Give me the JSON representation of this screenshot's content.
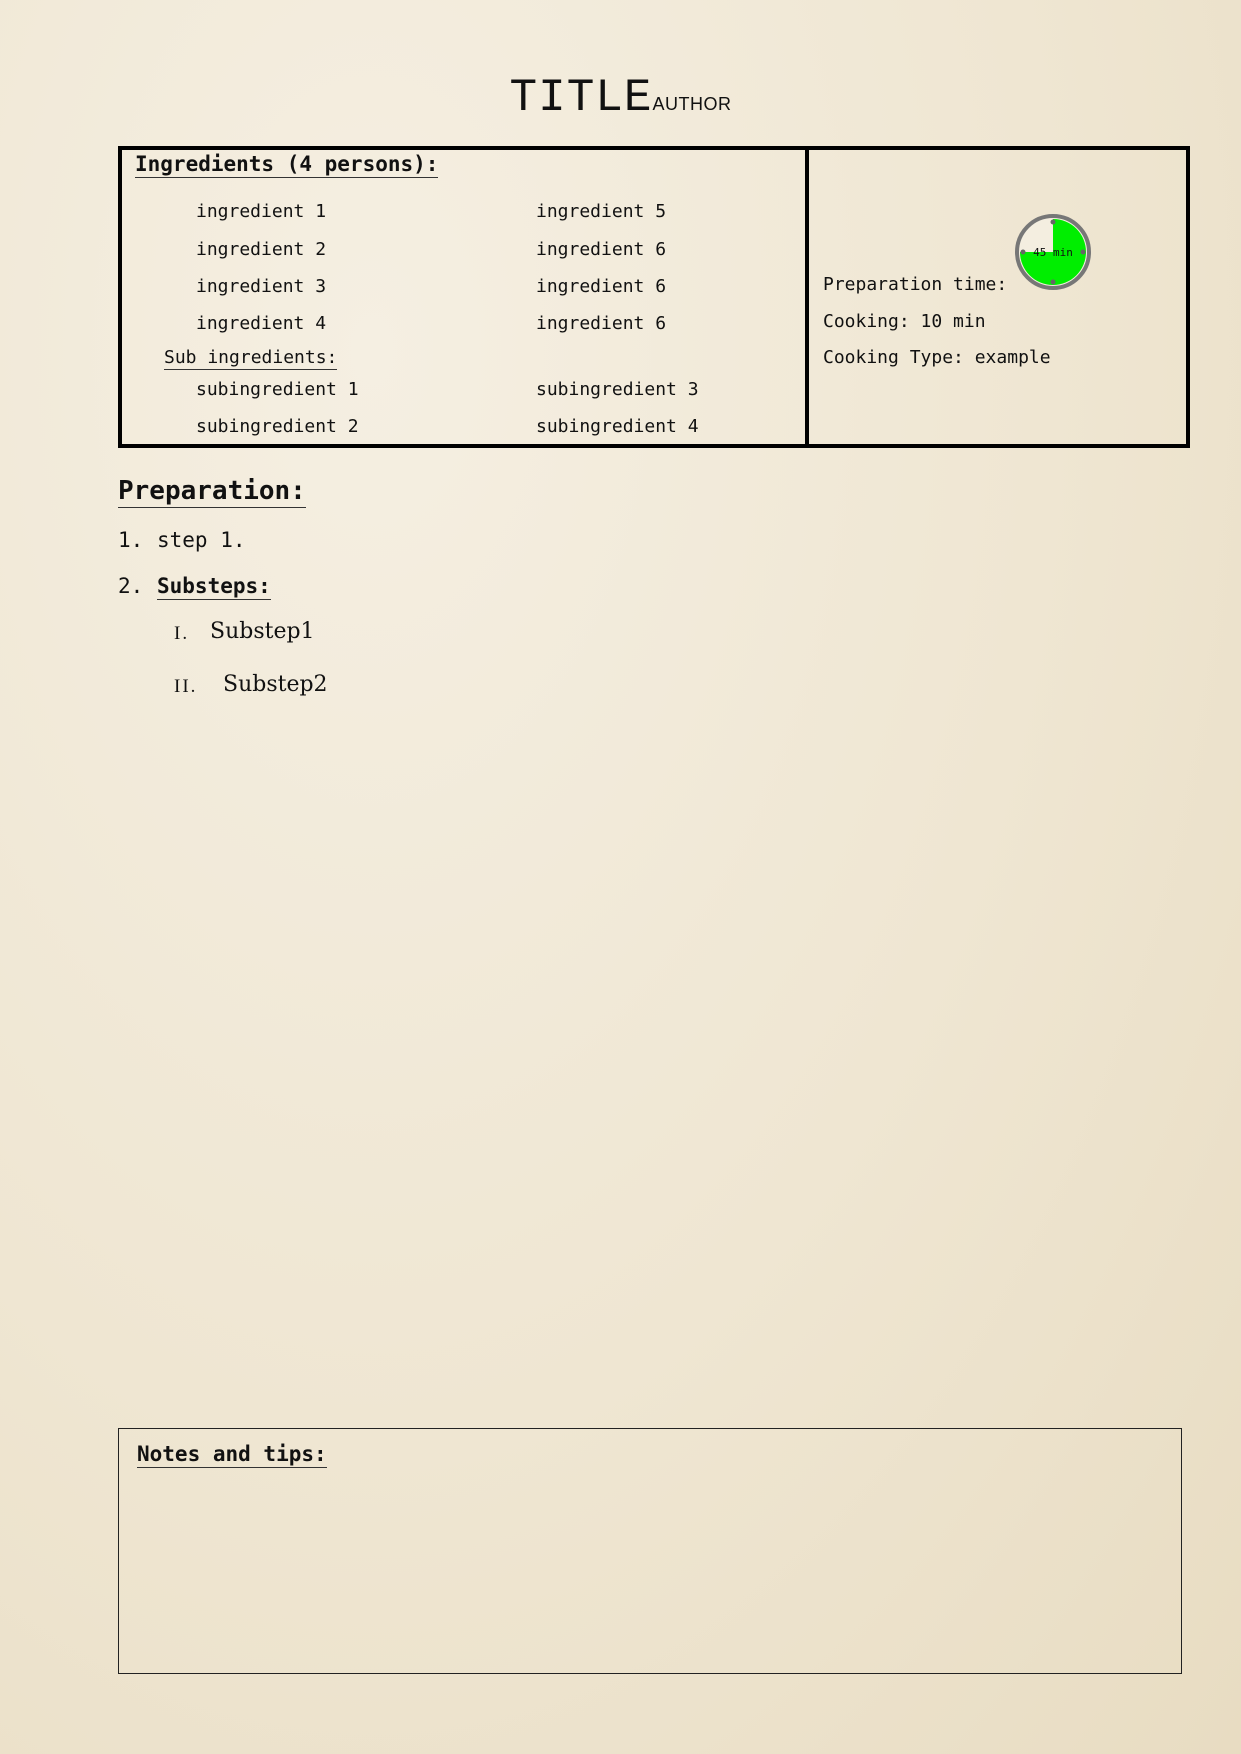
{
  "header": {
    "title": "TITLE",
    "author": "AUTHOR"
  },
  "ingredients": {
    "heading": "Ingredients (4 persons):",
    "left_column": [
      "ingredient 1",
      "ingredient 2",
      "ingredient 3",
      "ingredient 4"
    ],
    "right_column": [
      "ingredient 5",
      "ingredient 6",
      "ingredient 6",
      "ingredient 6"
    ],
    "sub_heading": "Sub ingredients:",
    "sub_left": [
      "subingredient 1",
      "subingredient 2"
    ],
    "sub_right": [
      "subingredient 3",
      "subingredient 4"
    ]
  },
  "info": {
    "preparation_time_label": "Preparation time:",
    "timer_label": "45 min",
    "timer_fraction": 0.75,
    "timer_color": "#00ee00",
    "cooking": "Cooking: 10 min",
    "cooking_type": "Cooking Type: example"
  },
  "preparation": {
    "heading": "Preparation:",
    "steps": [
      {
        "number": "1.",
        "text": "step 1."
      },
      {
        "number": "2.",
        "text": "Substeps:"
      }
    ],
    "substeps": [
      {
        "number": "I.",
        "text": "Substep1"
      },
      {
        "number": "II.",
        "text": "Substep2"
      }
    ]
  },
  "notes": {
    "heading": "Notes and tips:"
  }
}
